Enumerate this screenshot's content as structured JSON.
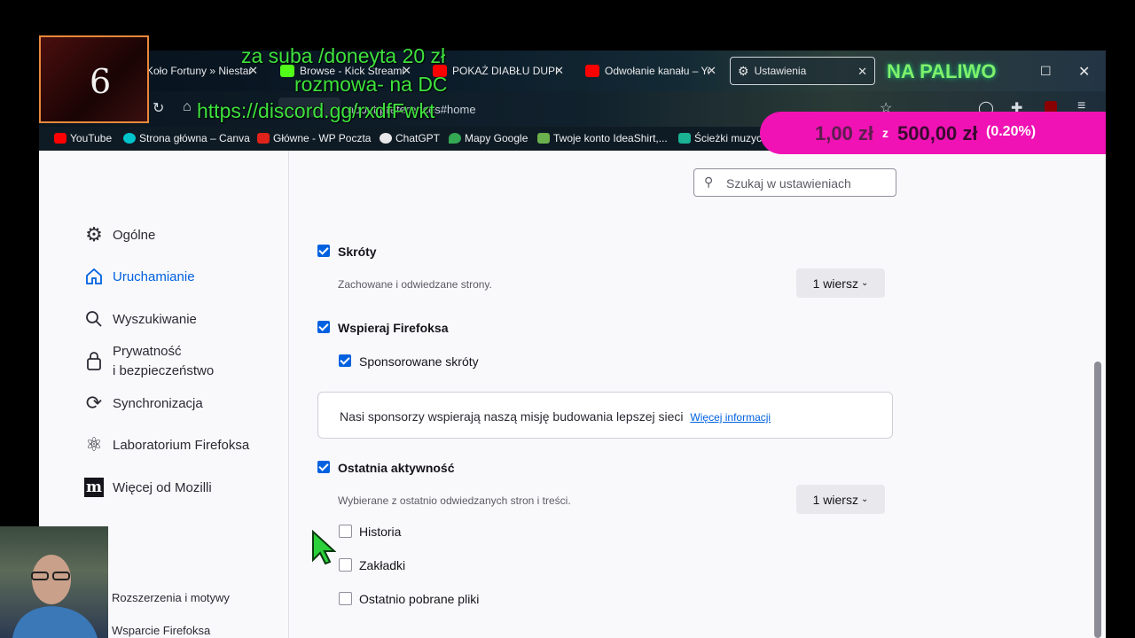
{
  "tabs": [
    {
      "label": "Koło Fortuny » Niestan",
      "color": "#c0392b"
    },
    {
      "label": "Browse - Kick Streami",
      "color": "#53fc18"
    },
    {
      "label": "POKAŻ DIABŁU DUPĘ",
      "color": "#ff0000"
    },
    {
      "label": "Odwołanie kanału – Yo",
      "color": "#ff0000"
    },
    {
      "label": "Ustawienia",
      "color": "#e8e8ea"
    }
  ],
  "navbar": {
    "url": "about:preferences#home"
  },
  "bookmarks": [
    {
      "label": "YouTube",
      "color": "#ff0000"
    },
    {
      "label": "Strona główna – Canva",
      "color": "#00c4cc"
    },
    {
      "label": "Główne - WP Poczta",
      "color": "#e0231a"
    },
    {
      "label": "ChatGPT",
      "color": "#e8e8ea"
    },
    {
      "label": "Mapy Google",
      "color": "#34a853"
    },
    {
      "label": "Twoje konto IdeaShirt,...",
      "color": "#6ab04c"
    },
    {
      "label": "Ścieżki muzyczne",
      "color": "#1ab394"
    }
  ],
  "search": {
    "placeholder": "Szukaj w ustawieniach"
  },
  "sidebar": {
    "items": [
      {
        "label": "Ogólne"
      },
      {
        "label": "Uruchamianie"
      },
      {
        "label": "Wyszukiwanie"
      },
      {
        "label_line1": "Prywatność",
        "label_line2": "i bezpieczeństwo"
      },
      {
        "label": "Synchronizacja"
      },
      {
        "label": "Laboratorium Firefoksa"
      },
      {
        "label": "Więcej od Mozilli"
      }
    ],
    "extensions": "Rozszerzenia i motywy",
    "support": "Wsparcie Firefoksa"
  },
  "options": {
    "shortcuts": {
      "label": "Skróty",
      "desc": "Zachowane i odwiedzane strony.",
      "rows": "1 wiersz",
      "checked": true
    },
    "support_firefox": {
      "label": "Wspieraj Firefoksa",
      "checked": true
    },
    "sponsored": {
      "label": "Sponsorowane skróty",
      "checked": true
    },
    "info": {
      "text": "Nasi sponsorzy wspierają naszą misję budowania lepszej sieci",
      "link": "Więcej informacji"
    },
    "recent": {
      "label": "Ostatnia aktywność",
      "desc": "Wybierane z ostatnio odwiedzanych stron i treści.",
      "rows": "1 wiersz",
      "checked": true
    },
    "history": {
      "label": "Historia",
      "checked": false
    },
    "bookmarks": {
      "label": "Zakładki",
      "checked": false
    },
    "downloads": {
      "label": "Ostatnio pobrane pliki",
      "checked": false
    }
  },
  "overlay": {
    "line1": "za suba /doneyta 20 zł",
    "line2": "rozmowa- na DC",
    "line3": "https://discord.gg/rxdfFwkt",
    "logo_number": "6",
    "na_paliwo": "NA PALIWO",
    "donation_current": "1,00 zł",
    "donation_of": "z",
    "donation_goal": "500,00 zł",
    "donation_percent": "(0.20%)"
  },
  "colors": {
    "accent": "#0061e0",
    "donation_bg": "#f012b4",
    "overlay_green": "#3ee23e"
  }
}
